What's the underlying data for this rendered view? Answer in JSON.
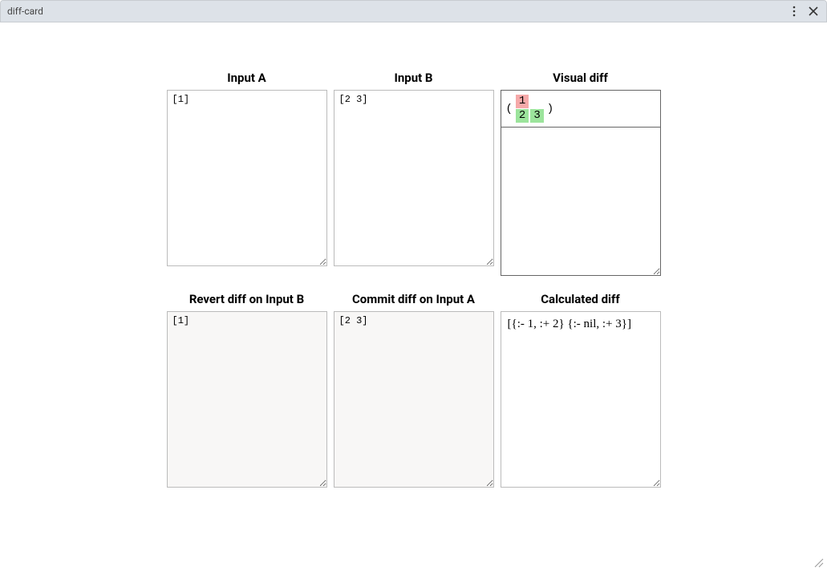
{
  "window": {
    "title": "diff-card"
  },
  "headings": {
    "input_a": "Input A",
    "input_b": "Input B",
    "visual_diff": "Visual diff",
    "revert": "Revert diff on Input B",
    "commit": "Commit diff on Input A",
    "calculated": "Calculated diff"
  },
  "inputs": {
    "a": "[1]",
    "b": "[2 3]"
  },
  "outputs": {
    "revert": "[1]",
    "commit": "[2 3]",
    "calculated": "[{:- 1, :+ 2} {:- nil, :+ 3}]"
  },
  "visual_diff": {
    "open_paren": "(",
    "close_paren": ")",
    "deleted": [
      "1"
    ],
    "added": [
      "2",
      "3"
    ]
  }
}
